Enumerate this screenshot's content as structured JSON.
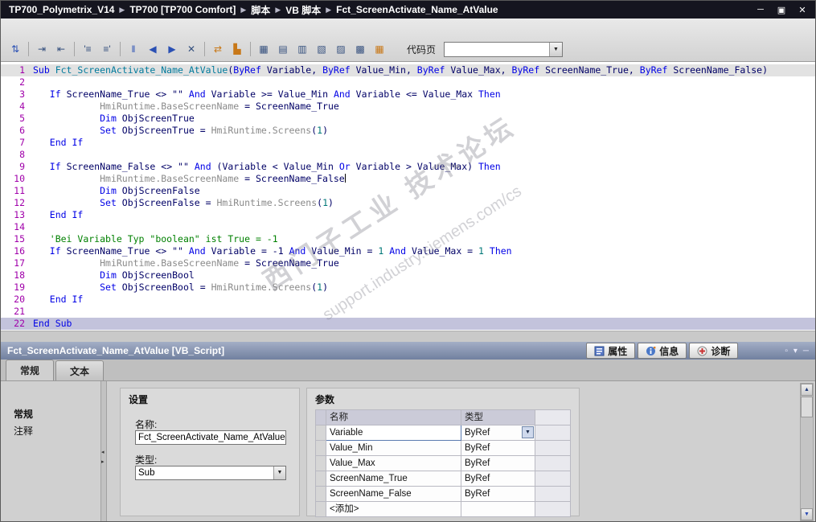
{
  "window": {
    "breadcrumb": [
      "TP700_Polymetrix_V14",
      "TP700 [TP700 Comfort]",
      "脚本",
      "VB 脚本",
      "Fct_ScreenActivate_Name_AtValue"
    ],
    "separator": "▶",
    "controls": {
      "minimize": "─",
      "restore": "▣",
      "close": "✕"
    }
  },
  "toolbar": {
    "codepage_label": "代码页",
    "codepage_value": "",
    "icons": [
      {
        "name": "goto-script-icon",
        "glyph": "⇅",
        "color": "#2a50b4"
      },
      {
        "sep": true
      },
      {
        "name": "indent-icon",
        "glyph": "⇥",
        "color": "#35507e"
      },
      {
        "name": "outdent-icon",
        "glyph": "⇤",
        "color": "#35507e"
      },
      {
        "sep": true
      },
      {
        "name": "comment-icon",
        "glyph": "'≡",
        "color": "#35507e"
      },
      {
        "name": "uncomment-icon",
        "glyph": "≡'",
        "color": "#35507e"
      },
      {
        "sep": true
      },
      {
        "name": "toggle-bookmark-icon",
        "glyph": "‖",
        "color": "#2a50b4"
      },
      {
        "name": "previous-bookmark-icon",
        "glyph": "◀",
        "color": "#2a50b4"
      },
      {
        "name": "next-bookmark-icon",
        "glyph": "▶",
        "color": "#2a50b4"
      },
      {
        "name": "clear-bookmarks-icon",
        "glyph": "✕",
        "color": "#35507e"
      },
      {
        "sep": true
      },
      {
        "name": "sync-changes-icon",
        "glyph": "⇄",
        "color": "#c87818"
      },
      {
        "name": "highlight-syntax-icon",
        "glyph": "▙",
        "color": "#c87818"
      },
      {
        "sep": true
      },
      {
        "name": "insert-field-icon",
        "glyph": "▦",
        "color": "#35507e"
      },
      {
        "name": "insert-table-icon",
        "glyph": "▤",
        "color": "#35507e"
      },
      {
        "name": "insert-row-icon",
        "glyph": "▥",
        "color": "#35507e"
      },
      {
        "name": "insert-column-icon",
        "glyph": "▧",
        "color": "#35507e"
      },
      {
        "name": "delete-row-icon",
        "glyph": "▨",
        "color": "#35507e"
      },
      {
        "name": "table-properties-icon",
        "glyph": "▩",
        "color": "#35507e"
      },
      {
        "name": "insert-function-icon",
        "glyph": "▦",
        "color": "#c87818"
      }
    ]
  },
  "editor": {
    "lines": [
      {
        "n": 1,
        "bg": "bg-active",
        "tokens": [
          [
            "kw",
            "Sub"
          ],
          [
            "fn",
            " Fct_ScreenActivate_Name_AtValue"
          ],
          [
            "pl",
            "("
          ],
          [
            "kw",
            "ByRef"
          ],
          [
            "pl",
            " Variable, "
          ],
          [
            "kw",
            "ByRef"
          ],
          [
            "pl",
            " Value_Min, "
          ],
          [
            "kw",
            "ByRef"
          ],
          [
            "pl",
            " Value_Max, "
          ],
          [
            "kw",
            "ByRef"
          ],
          [
            "pl",
            " ScreenName_True, "
          ],
          [
            "kw",
            "ByRef"
          ],
          [
            "pl",
            " ScreenName_False)"
          ]
        ]
      },
      {
        "n": 2,
        "tokens": []
      },
      {
        "n": 3,
        "tokens": [
          [
            "pl",
            "   "
          ],
          [
            "kw",
            "If"
          ],
          [
            "pl",
            " ScreenName_True <> "
          ],
          [
            "str",
            "\"\""
          ],
          [
            "pl",
            " "
          ],
          [
            "kw",
            "And"
          ],
          [
            "pl",
            " Variable >= Value_Min "
          ],
          [
            "kw",
            "And"
          ],
          [
            "pl",
            " Variable <= Value_Max "
          ],
          [
            "kw",
            "Then"
          ]
        ]
      },
      {
        "n": 4,
        "tokens": [
          [
            "pl",
            "            "
          ],
          [
            "obj",
            "HmiRuntime.BaseScreenName"
          ],
          [
            "pl",
            " = ScreenName_True"
          ]
        ]
      },
      {
        "n": 5,
        "tokens": [
          [
            "pl",
            "            "
          ],
          [
            "kw",
            "Dim"
          ],
          [
            "pl",
            " ObjScreenTrue"
          ]
        ]
      },
      {
        "n": 6,
        "tokens": [
          [
            "pl",
            "            "
          ],
          [
            "kw",
            "Set"
          ],
          [
            "pl",
            " ObjScreenTrue = "
          ],
          [
            "obj",
            "HmiRuntime.Screens"
          ],
          [
            "pl",
            "("
          ],
          [
            "num",
            "1"
          ],
          [
            "pl",
            ")"
          ]
        ]
      },
      {
        "n": 7,
        "tokens": [
          [
            "pl",
            "   "
          ],
          [
            "kw",
            "End If"
          ]
        ]
      },
      {
        "n": 8,
        "tokens": []
      },
      {
        "n": 9,
        "tokens": [
          [
            "pl",
            "   "
          ],
          [
            "kw",
            "If"
          ],
          [
            "pl",
            " ScreenName_False <> "
          ],
          [
            "str",
            "\"\""
          ],
          [
            "pl",
            " "
          ],
          [
            "kw",
            "And"
          ],
          [
            "pl",
            " (Variable < Value_Min "
          ],
          [
            "kw",
            "Or"
          ],
          [
            "pl",
            " Variable > Value_Max) "
          ],
          [
            "kw",
            "Then"
          ]
        ]
      },
      {
        "n": 10,
        "tokens": [
          [
            "pl",
            "            "
          ],
          [
            "obj",
            "HmiRuntime.BaseScreenName"
          ],
          [
            "pl",
            " = ScreenName_False"
          ],
          [
            "caret",
            ""
          ]
        ]
      },
      {
        "n": 11,
        "tokens": [
          [
            "pl",
            "            "
          ],
          [
            "kw",
            "Dim"
          ],
          [
            "pl",
            " ObjScreenFalse"
          ]
        ]
      },
      {
        "n": 12,
        "tokens": [
          [
            "pl",
            "            "
          ],
          [
            "kw",
            "Set"
          ],
          [
            "pl",
            " ObjScreenFalse = "
          ],
          [
            "obj",
            "HmiRuntime.Screens"
          ],
          [
            "pl",
            "("
          ],
          [
            "num",
            "1"
          ],
          [
            "pl",
            ")"
          ]
        ]
      },
      {
        "n": 13,
        "tokens": [
          [
            "pl",
            "   "
          ],
          [
            "kw",
            "End If"
          ]
        ]
      },
      {
        "n": 14,
        "tokens": []
      },
      {
        "n": 15,
        "tokens": [
          [
            "pl",
            "   "
          ],
          [
            "cmt",
            "'Bei Variable Typ \"boolean\" ist True = -1"
          ]
        ]
      },
      {
        "n": 16,
        "tokens": [
          [
            "pl",
            "   "
          ],
          [
            "kw",
            "If"
          ],
          [
            "pl",
            " ScreenName_True <> "
          ],
          [
            "str",
            "\"\""
          ],
          [
            "pl",
            " "
          ],
          [
            "kw",
            "And"
          ],
          [
            "pl",
            " Variable = -1 "
          ],
          [
            "kw",
            "And"
          ],
          [
            "pl",
            " Value_Min = "
          ],
          [
            "num",
            "1"
          ],
          [
            "pl",
            " "
          ],
          [
            "kw",
            "And"
          ],
          [
            "pl",
            " Value_Max = "
          ],
          [
            "num",
            "1"
          ],
          [
            "pl",
            " "
          ],
          [
            "kw",
            "Then"
          ]
        ]
      },
      {
        "n": 17,
        "tokens": [
          [
            "pl",
            "            "
          ],
          [
            "obj",
            "HmiRuntime.BaseScreenName"
          ],
          [
            "pl",
            " = ScreenName_True"
          ]
        ]
      },
      {
        "n": 18,
        "tokens": [
          [
            "pl",
            "            "
          ],
          [
            "kw",
            "Dim"
          ],
          [
            "pl",
            " ObjScreenBool"
          ]
        ]
      },
      {
        "n": 19,
        "tokens": [
          [
            "pl",
            "            "
          ],
          [
            "kw",
            "Set"
          ],
          [
            "pl",
            " ObjScreenBool = "
          ],
          [
            "obj",
            "HmiRuntime.Screens"
          ],
          [
            "pl",
            "("
          ],
          [
            "num",
            "1"
          ],
          [
            "pl",
            ")"
          ]
        ]
      },
      {
        "n": 20,
        "tokens": [
          [
            "pl",
            "   "
          ],
          [
            "kw",
            "End If"
          ]
        ]
      },
      {
        "n": 21,
        "tokens": []
      },
      {
        "n": 22,
        "bg": "bg-sel",
        "tokens": [
          [
            "kw",
            "End Sub"
          ]
        ]
      }
    ]
  },
  "inspector": {
    "title": "Fct_ScreenActivate_Name_AtValue [VB_Script]",
    "header_tabs": [
      {
        "label": "属性"
      },
      {
        "label": "信息"
      },
      {
        "label": "诊断"
      }
    ],
    "view_tabs": [
      {
        "label": "常规",
        "active": true
      },
      {
        "label": "文本",
        "active": false
      }
    ],
    "nav_items": [
      {
        "label": "常规",
        "active": true
      },
      {
        "label": "注释",
        "active": false
      }
    ],
    "settings": {
      "title": "设置",
      "name_label": "名称:",
      "name_value": "Fct_ScreenActivate_Name_AtValue",
      "type_label": "类型:",
      "type_value": "Sub"
    },
    "parameters": {
      "title": "参数",
      "columns": [
        "名称",
        "类型"
      ],
      "rows": [
        {
          "name": "Variable",
          "type": "ByRef",
          "selected": true
        },
        {
          "name": "Value_Min",
          "type": "ByRef"
        },
        {
          "name": "Value_Max",
          "type": "ByRef"
        },
        {
          "name": "ScreenName_True",
          "type": "ByRef"
        },
        {
          "name": "ScreenName_False",
          "type": "ByRef"
        },
        {
          "name": "<添加>",
          "type": "",
          "placeholder": true
        }
      ]
    }
  },
  "watermark": {
    "line1": "西门子工业 技术论坛",
    "line2": "support.industry.siemens.com/cs"
  },
  "colors": {
    "titlebar_bg": "#15151f",
    "keyword": "#0000e6",
    "comment": "#008000",
    "object_gray": "#8a8a8a",
    "line_selection": "#c3c3dc",
    "inspector_header": "#71809f"
  }
}
